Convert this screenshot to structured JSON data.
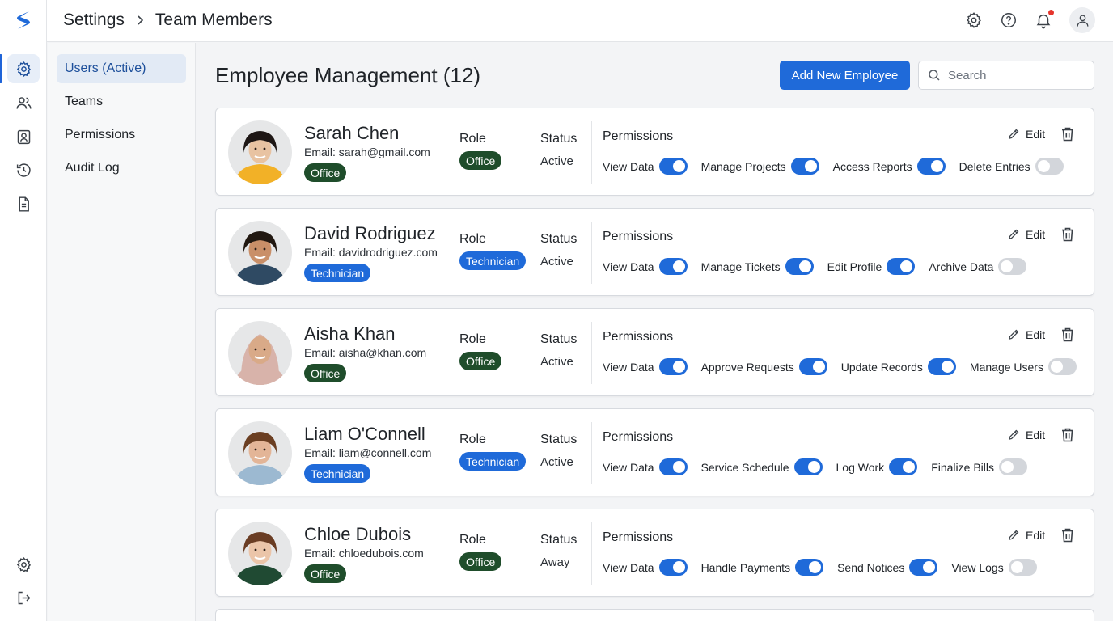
{
  "header": {
    "breadcrumb_root": "Settings",
    "breadcrumb_current": "Team Members",
    "icons": [
      "gear-icon",
      "help-icon",
      "bell-icon",
      "user-icon"
    ]
  },
  "rail": {
    "items": [
      "settings-icon",
      "people-icon",
      "contact-card-icon",
      "history-icon",
      "document-icon"
    ],
    "bottom": [
      "settings-icon",
      "logout-icon"
    ],
    "active_index": 0
  },
  "subnav": {
    "items": [
      {
        "label": "Users (Active)",
        "active": true
      },
      {
        "label": "Teams",
        "active": false
      },
      {
        "label": "Permissions",
        "active": false
      },
      {
        "label": "Audit Log",
        "active": false
      }
    ]
  },
  "main": {
    "title": "Employee Management (12)",
    "add_button": "Add New Employee",
    "search_placeholder": "Search"
  },
  "labels": {
    "role": "Role",
    "status": "Status",
    "permissions": "Permissions",
    "edit": "Edit"
  },
  "employees": [
    {
      "name": "Sarah Chen",
      "email": "Email: sarah@gmail.com",
      "badge": "Office",
      "role": "Office",
      "status": "Active",
      "permissions": [
        {
          "name": "View Data",
          "on": true
        },
        {
          "name": "Manage Projects",
          "on": true
        },
        {
          "name": "Access Reports",
          "on": true
        },
        {
          "name": "Delete Entries",
          "on": false
        }
      ]
    },
    {
      "name": "David Rodriguez",
      "email": "Email: davidrodriguez.com",
      "badge": "Technician",
      "role": "Technician",
      "status": "Active",
      "permissions": [
        {
          "name": "View Data",
          "on": true
        },
        {
          "name": "Manage Tickets",
          "on": true
        },
        {
          "name": "Edit Profile",
          "on": true
        },
        {
          "name": "Archive Data",
          "on": false
        }
      ]
    },
    {
      "name": "Aisha Khan",
      "email": "Email: aisha@khan.com",
      "badge": "Office",
      "role": "Office",
      "status": "Active",
      "permissions": [
        {
          "name": "View Data",
          "on": true
        },
        {
          "name": "Approve Requests",
          "on": true
        },
        {
          "name": "Update Records",
          "on": true
        },
        {
          "name": "Manage Users",
          "on": false
        }
      ]
    },
    {
      "name": "Liam O'Connell",
      "email": "Email: liam@connell.com",
      "badge": "Technician",
      "role": "Technician",
      "status": "Active",
      "permissions": [
        {
          "name": "View Data",
          "on": true
        },
        {
          "name": "Service Schedule",
          "on": true
        },
        {
          "name": "Log Work",
          "on": true
        },
        {
          "name": "Finalize Bills",
          "on": false
        }
      ]
    },
    {
      "name": "Chloe Dubois",
      "email": "Email: chloedubois.com",
      "badge": "Office",
      "role": "Office",
      "status": "Away",
      "permissions": [
        {
          "name": "View Data",
          "on": true
        },
        {
          "name": "Handle Payments",
          "on": true
        },
        {
          "name": "Send Notices",
          "on": true
        },
        {
          "name": "View Logs",
          "on": false
        }
      ]
    }
  ],
  "colors": {
    "accent": "#1f6ad9",
    "office_badge": "#1f4d2b",
    "toggle_off": "#d3d6db"
  }
}
